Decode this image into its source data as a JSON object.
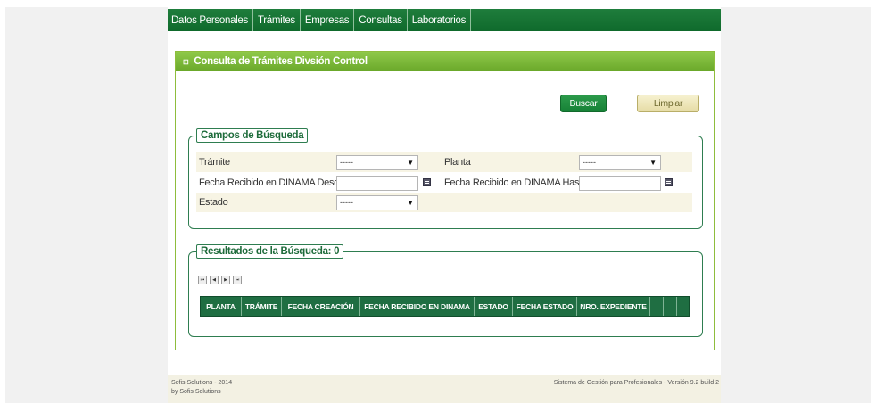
{
  "nav": {
    "items": [
      "Datos Personales",
      "Trámites",
      "Empresas",
      "Consultas",
      "Laboratorios"
    ]
  },
  "panel": {
    "title": "Consulta de Trámites Divsión Control",
    "expand_glyph": "⊞",
    "buttons": {
      "buscar": "Buscar",
      "limpiar": "Limpiar"
    }
  },
  "search": {
    "legend": "Campos de Búsqueda",
    "tramite_label": "Trámite",
    "tramite_value": "-----",
    "planta_label": "Planta",
    "planta_value": "-----",
    "fecha_desde_label": "Fecha Recibido en DINAMA Desde",
    "fecha_desde_value": "",
    "fecha_hasta_label": "Fecha Recibido en DINAMA Hasta",
    "fecha_hasta_value": "",
    "estado_label": "Estado",
    "estado_value": "-----"
  },
  "results": {
    "legend": "Resultados de la Búsqueda: 0",
    "pager": [
      "⏮",
      "◀",
      "▶",
      "⏭"
    ],
    "columns": [
      "PLANTA",
      "TRÁMITE",
      "FECHA CREACIÓN",
      "FECHA RECIBIDO EN DINAMA",
      "ESTADO",
      "FECHA ESTADO",
      "NRO. EXPEDIENTE",
      "",
      "",
      ""
    ]
  },
  "footer": {
    "line1": "Sofis Solutions - 2014",
    "line2": "by Sofis Solutions",
    "right": "Sistema de Gestión para Profesionales - Versión 9.2 build 2"
  },
  "colors": {
    "nav": "#0f6a2c",
    "panel_header": "#7cb83a",
    "grid_header": "#1f6e42",
    "legend_text": "#1d6b3a"
  }
}
